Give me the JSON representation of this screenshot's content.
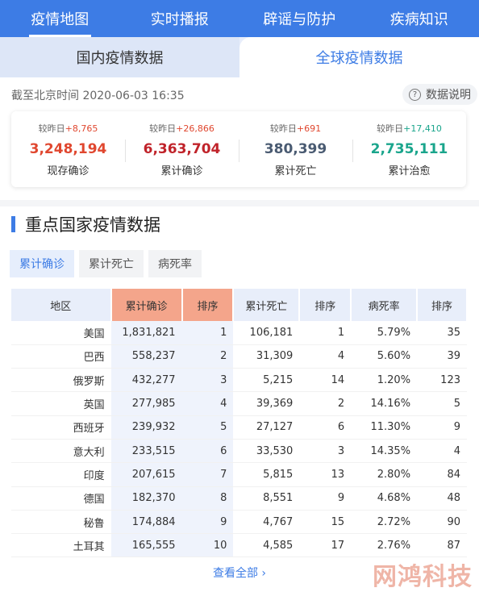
{
  "nav": [
    {
      "label": "疫情地图",
      "active": true
    },
    {
      "label": "实时播报",
      "active": false
    },
    {
      "label": "辟谣与防护",
      "active": false
    },
    {
      "label": "疾病知识",
      "active": false
    }
  ],
  "subtabs": {
    "domestic": "国内疫情数据",
    "global": "全球疫情数据"
  },
  "timestamp": "截至北京时间 2020-06-03 16:35",
  "explain_label": "数据说明",
  "stats": [
    {
      "delta_label": "较昨日",
      "delta": "+8,765",
      "value": "3,248,194",
      "label": "现存确诊",
      "color": "#e0472f"
    },
    {
      "delta_label": "较昨日",
      "delta": "+26,866",
      "value": "6,363,704",
      "label": "累计确诊",
      "color": "#c0232a"
    },
    {
      "delta_label": "较昨日",
      "delta": "+691",
      "value": "380,399",
      "label": "累计死亡",
      "color": "#4a5b72"
    },
    {
      "delta_label": "较昨日",
      "delta": "+17,410",
      "value": "2,735,111",
      "label": "累计治愈",
      "color": "#1aa58c"
    }
  ],
  "section_title": "重点国家疫情数据",
  "filters": [
    {
      "label": "累计确诊",
      "active": true
    },
    {
      "label": "累计死亡",
      "active": false
    },
    {
      "label": "病死率",
      "active": false
    }
  ],
  "table": {
    "headers": [
      "地区",
      "累计确诊",
      "排序",
      "累计死亡",
      "排序",
      "病死率",
      "排序"
    ],
    "rows": [
      [
        "美国",
        "1,831,821",
        "1",
        "106,181",
        "1",
        "5.79%",
        "35"
      ],
      [
        "巴西",
        "558,237",
        "2",
        "31,309",
        "4",
        "5.60%",
        "39"
      ],
      [
        "俄罗斯",
        "432,277",
        "3",
        "5,215",
        "14",
        "1.20%",
        "123"
      ],
      [
        "英国",
        "277,985",
        "4",
        "39,369",
        "2",
        "14.16%",
        "5"
      ],
      [
        "西班牙",
        "239,932",
        "5",
        "27,127",
        "6",
        "11.30%",
        "9"
      ],
      [
        "意大利",
        "233,515",
        "6",
        "33,530",
        "3",
        "14.35%",
        "4"
      ],
      [
        "印度",
        "207,615",
        "7",
        "5,815",
        "13",
        "2.80%",
        "84"
      ],
      [
        "德国",
        "182,370",
        "8",
        "8,551",
        "9",
        "4.68%",
        "48"
      ],
      [
        "秘鲁",
        "174,884",
        "9",
        "4,767",
        "15",
        "2.72%",
        "90"
      ],
      [
        "土耳其",
        "165,555",
        "10",
        "4,585",
        "17",
        "2.76%",
        "87"
      ]
    ]
  },
  "view_all": "查看全部 ›",
  "watermark": "网鸿科技",
  "colors": {
    "accent": "#3d7ce5",
    "highlight": "#f4a58b",
    "delta_red": "#e0472f",
    "delta_green": "#1aa58c"
  }
}
